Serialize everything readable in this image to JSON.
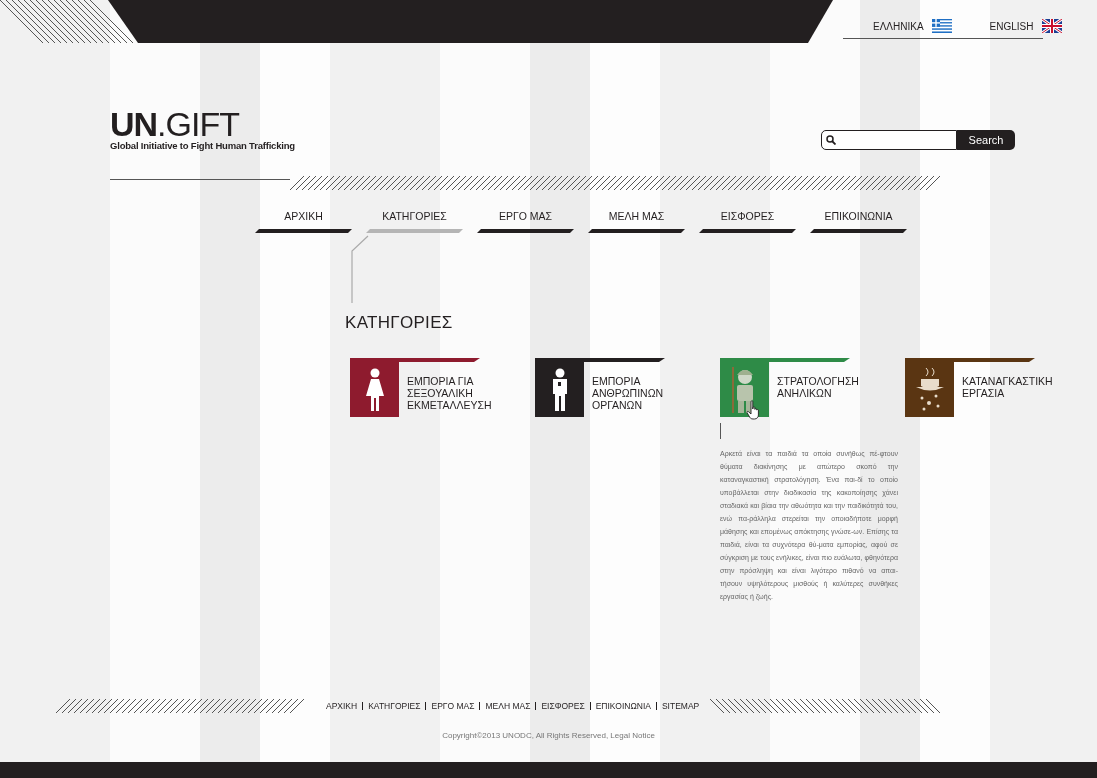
{
  "languages": [
    {
      "label": "ΕΛΛΗΝΙΚΑ",
      "kind": "greece"
    },
    {
      "label": "ENGLISH",
      "kind": "uk"
    }
  ],
  "logo": {
    "title": "**UN**.GIFT",
    "tagline": "Global Initiative to Fight Human Trafficking"
  },
  "search": {
    "button": "Search"
  },
  "nav": [
    {
      "label": "ΑΡΧΙΚΗ",
      "selected": false
    },
    {
      "label": "ΚΑΤΗΓΟΡΙΕΣ",
      "selected": true
    },
    {
      "label": "ΕΡΓΟ ΜΑΣ",
      "selected": false
    },
    {
      "label": "ΜΕΛΗ ΜΑΣ",
      "selected": false
    },
    {
      "label": "ΕΙΣΦΟΡΕΣ",
      "selected": false
    },
    {
      "label": "ΕΠΙΚΟΙΝΩΝΙΑ",
      "selected": false
    }
  ],
  "heading": "ΚΑΤΗΓΟΡΙΕΣ",
  "categories": [
    {
      "kind": "woman",
      "color": "#8e1b2e",
      "lines": [
        "ΕΜΠΟΡΙΑ ΓΙΑ",
        "ΣΕΞΟΥΑΛΙΚΗ",
        "ΕΚΜΕΤΑΛΛΕΥΣΗ"
      ],
      "selected": false
    },
    {
      "kind": "man",
      "color": "#231f20",
      "lines": [
        "ΕΜΠΟΡΙΑ",
        "ΑΝΘΡΩΠΙΝΩΝ",
        "ΟΡΓΑΝΩΝ"
      ],
      "selected": false
    },
    {
      "kind": "soldier",
      "color": "#2e8b47",
      "lines": [
        "ΣΤΡΑΤΟΛΟΓΗΣΗ",
        "ΑΝΗΛΙΚΩΝ"
      ],
      "selected": true,
      "description": "Αρκετά είναι τα παιδιά τα οποία συνήθως πέ-φτουν θύματα διακίνησης με απώτερο σκοπό την καταναγκαστική στρατολόγηση. Ένα παι-δί το οποίο υποβάλλεται στην διαδικασία της κακοποίησης χάνει σταδιακά και βίαια την αθωότητα και την παιδικότητά του, ενώ πα-ράλληλα στερείται την οποιαδήποτε μορφή μάθησης και επομένως απόκτησης γνώσε-ων. Επίσης τα παιδιά, είναι τα συχνότερα θύ-ματα εμπορίας, αφού σε σύγκριση με τους ενήλικες, είναι πιο ευάλωτα, φθηνότερα στην πρόσληψη και είναι λιγότερο πιθανό να απαι-τήσουν υψηλότερους μισθούς ή καλύτερες συνθήκες εργασίας ή ζωής."
    },
    {
      "kind": "coffee",
      "color": "#5a3512",
      "lines": [
        "ΚΑΤΑΝΑΓΚΑΣΤΙΚΗ",
        "ΕΡΓΑΣΙΑ"
      ],
      "selected": false
    }
  ],
  "footer": {
    "links": [
      "ΑΡΧΙΚΗ",
      "ΚΑΤΗΓΟΡΙΕΣ",
      "ΕΡΓΟ ΜΑΣ",
      "ΜΕΛΗ ΜΑΣ",
      "ΕΙΣΦΟΡΕΣ",
      "ΕΠΙΚΟΙΝΩΝΙΑ",
      "SITEMAP"
    ],
    "copyright": "Copyright©2013 UNODC, All Rights Reserved, Legal Notice"
  }
}
